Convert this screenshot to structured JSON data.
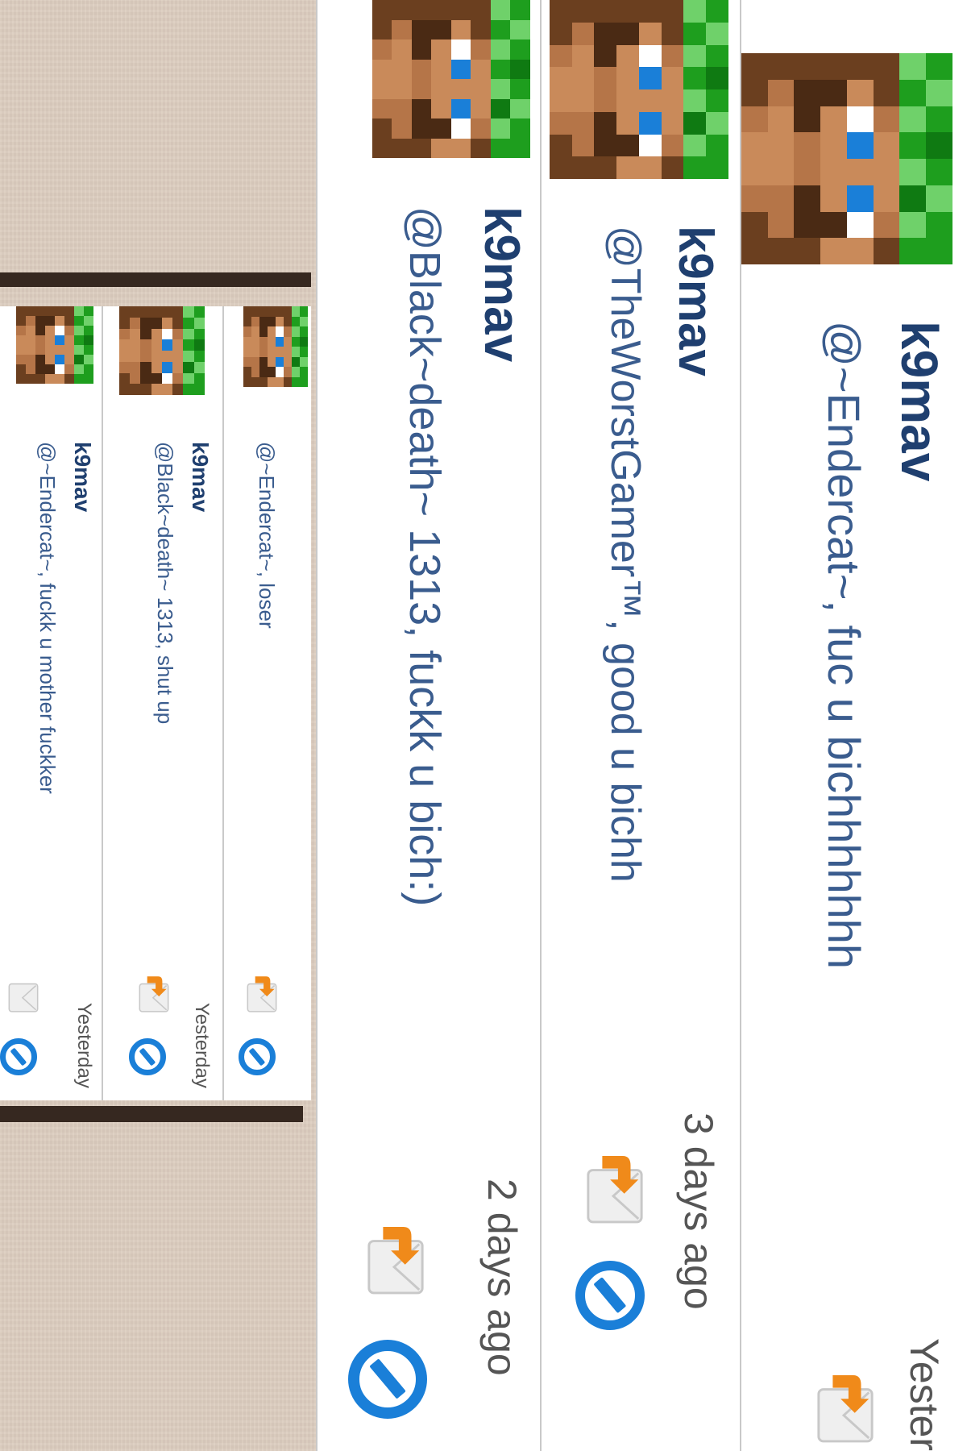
{
  "comments": [
    {
      "username": "k9mav",
      "text": "@~Endercat~, fuc u bichhhhhhh",
      "time": "Yesterday"
    },
    {
      "username": "k9mav",
      "text": "@TheWorstGamer™, good u bichh",
      "time": "3 days ago"
    },
    {
      "username": "k9mav",
      "text": "@Black~death~ 1313, fuckk u bich:)",
      "time": "2 days ago"
    },
    {
      "username": "",
      "text": "@~Endercat~, loser",
      "time": ""
    },
    {
      "username": "k9mav",
      "text": "@Black~death~ 1313, shut up",
      "time": "Yesterday"
    },
    {
      "username": "k9mav",
      "text": "@~Endercat~, fuckk u mother fuckker",
      "time": "Yesterday"
    }
  ],
  "icons": {
    "avatar": "creeper-steve-avatar-icon",
    "reply": "reply-envelope-icon",
    "block": "block-icon"
  },
  "colors": {
    "username": "#1f3f6f",
    "comment_text": "#3a5c8e",
    "block_blue": "#1a7fd8",
    "reply_orange": "#f08a1a"
  }
}
